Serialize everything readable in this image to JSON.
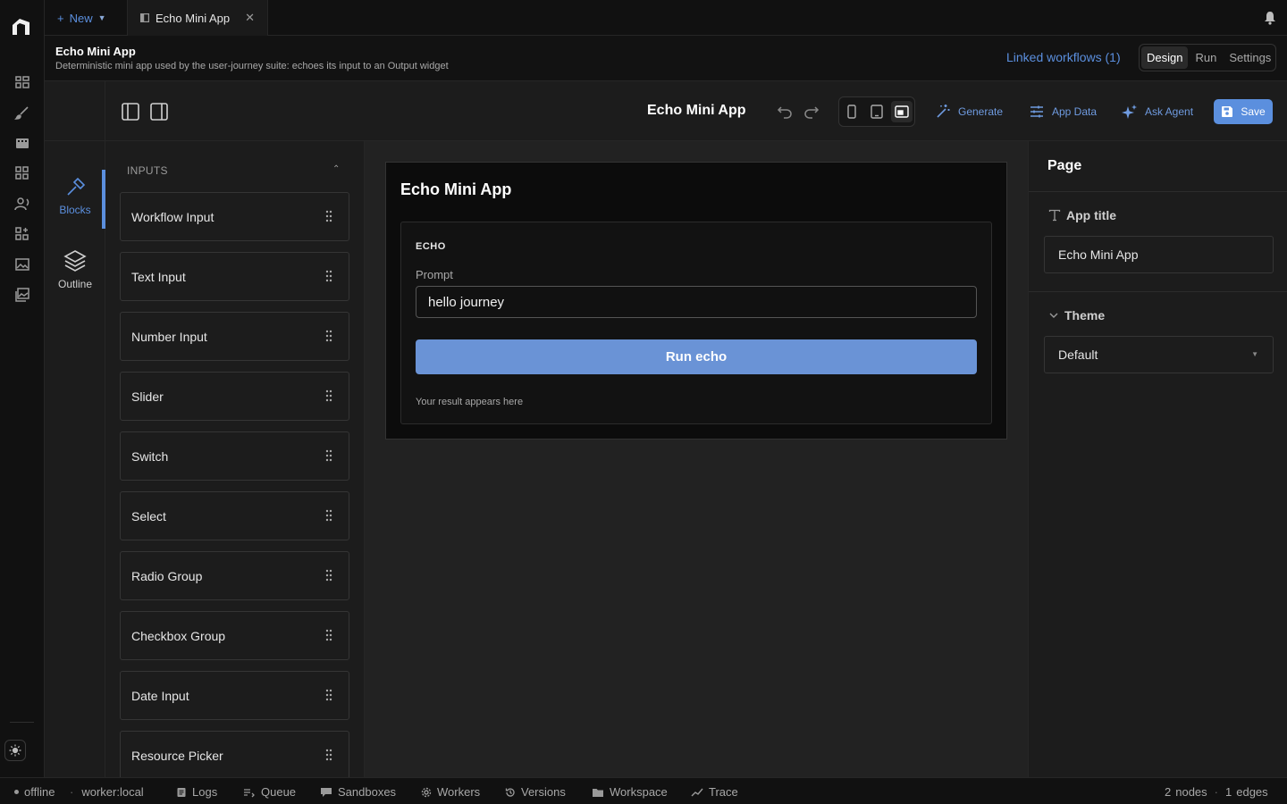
{
  "tabbar": {
    "new_label": "New",
    "tab_label": "Echo Mini App"
  },
  "app_header": {
    "title": "Echo Mini App",
    "description": "Deterministic mini app used by the user-journey suite: echoes its input to an Output widget",
    "linked_workflows": "Linked workflows (1)",
    "modes": [
      "Design",
      "Run",
      "Settings"
    ],
    "active_mode": "Design"
  },
  "toolbar": {
    "app_title": "Echo Mini App",
    "generate_label": "Generate",
    "app_data_label": "App Data",
    "ask_agent_label": "Ask Agent",
    "save_label": "Save",
    "active_device": "desktop"
  },
  "sidenav": {
    "items": [
      {
        "label": "Blocks",
        "icon": "hammer-icon",
        "active": true
      },
      {
        "label": "Outline",
        "icon": "layers-icon",
        "active": false
      }
    ]
  },
  "blocks": {
    "section_title": "INPUTS",
    "items": [
      {
        "label": "Workflow Input"
      },
      {
        "label": "Text Input"
      },
      {
        "label": "Number Input"
      },
      {
        "label": "Slider"
      },
      {
        "label": "Switch"
      },
      {
        "label": "Select"
      },
      {
        "label": "Radio Group"
      },
      {
        "label": "Checkbox Group"
      },
      {
        "label": "Date Input"
      },
      {
        "label": "Resource Picker"
      }
    ]
  },
  "preview": {
    "title": "Echo Mini App",
    "section": "ECHO",
    "prompt_label": "Prompt",
    "prompt_value": "hello journey",
    "run_label": "Run echo",
    "result_placeholder": "Your result appears here"
  },
  "inspector": {
    "heading": "Page",
    "app_title_label": "App title",
    "app_title_value": "Echo Mini App",
    "theme_label": "Theme",
    "theme_value": "Default"
  },
  "statusbar": {
    "status": "offline",
    "worker": "worker:local",
    "items": [
      {
        "label": "Logs",
        "icon": "file-icon"
      },
      {
        "label": "Queue",
        "icon": "queue-icon"
      },
      {
        "label": "Sandboxes",
        "icon": "chat-icon"
      },
      {
        "label": "Workers",
        "icon": "gear-icon"
      },
      {
        "label": "Versions",
        "icon": "history-icon"
      },
      {
        "label": "Workspace",
        "icon": "folder-icon"
      },
      {
        "label": "Trace",
        "icon": "trend-icon"
      }
    ],
    "nodes_count": "2",
    "nodes_label": "nodes",
    "edges_count": "1",
    "edges_label": "edges"
  },
  "colors": {
    "accent": "#5b8fde",
    "run_button": "#6a93d6",
    "background": "#1c1c1c"
  }
}
